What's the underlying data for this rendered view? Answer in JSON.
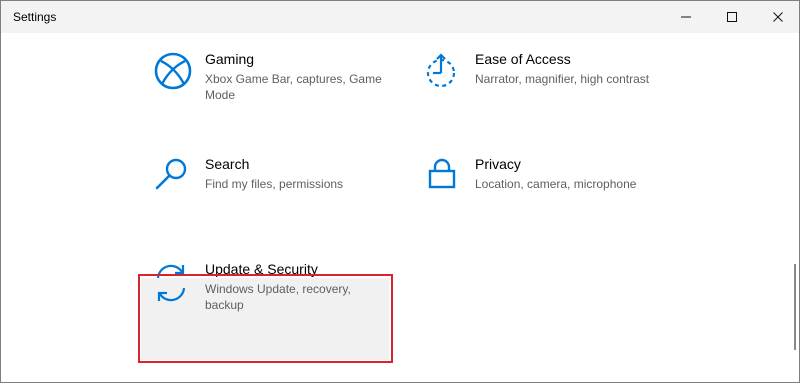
{
  "window": {
    "title": "Settings"
  },
  "colors": {
    "accent": "#0078D7",
    "highlight_border": "#D9242F",
    "title_bar": "#F3F3F3",
    "description_text": "#5F5F5F"
  },
  "tiles": [
    {
      "icon": "xbox-icon",
      "label": "Gaming",
      "description": "Xbox Game Bar, captures, Game Mode"
    },
    {
      "icon": "ease-of-access-icon",
      "label": "Ease of Access",
      "description": "Narrator, magnifier, high contrast"
    },
    {
      "icon": "search-icon",
      "label": "Search",
      "description": "Find my files, permissions"
    },
    {
      "icon": "lock-icon",
      "label": "Privacy",
      "description": "Location, camera, microphone"
    },
    {
      "icon": "sync-icon",
      "label": "Update & Security",
      "description": "Windows Update, recovery, backup",
      "highlighted": true
    }
  ]
}
